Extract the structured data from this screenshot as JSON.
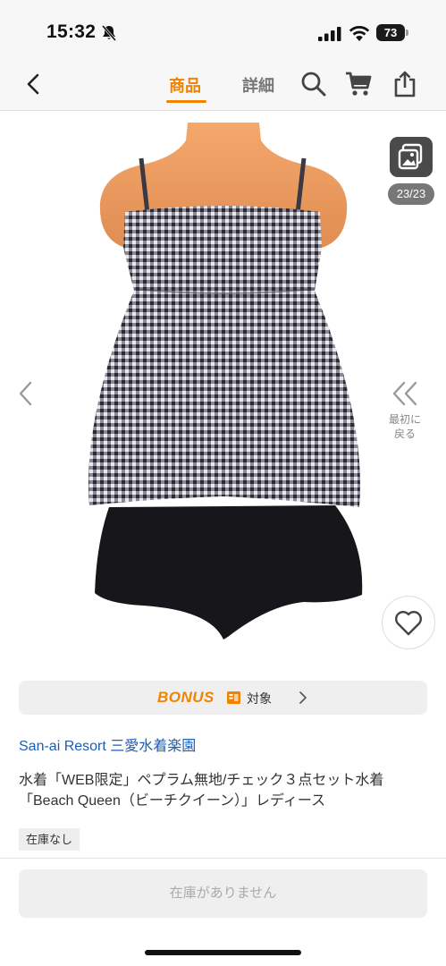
{
  "status_bar": {
    "time": "15:32",
    "battery": "73"
  },
  "header": {
    "tabs": [
      {
        "label": "商品",
        "active": true
      },
      {
        "label": "詳細",
        "active": false
      }
    ],
    "accent_color": "#f08300"
  },
  "gallery": {
    "counter": "23/23",
    "first_label_line1": "最初に",
    "first_label_line2": "戻る"
  },
  "bonus": {
    "logo": "BONUS",
    "target_label": "対象"
  },
  "shop": {
    "name": "San-ai Resort 三愛水着楽園"
  },
  "product": {
    "title": "水着「WEB限定」ペプラム無地/チェック３点セット水着「Beach Queen（ビーチクイーン）」レディース",
    "stock_status": "在庫なし"
  },
  "cta": {
    "label": "在庫がありません"
  },
  "icons": [
    "chevron-left-icon",
    "search-icon",
    "cart-icon",
    "share-icon",
    "gallery-icon",
    "heart-icon",
    "double-chevron-left-icon"
  ]
}
